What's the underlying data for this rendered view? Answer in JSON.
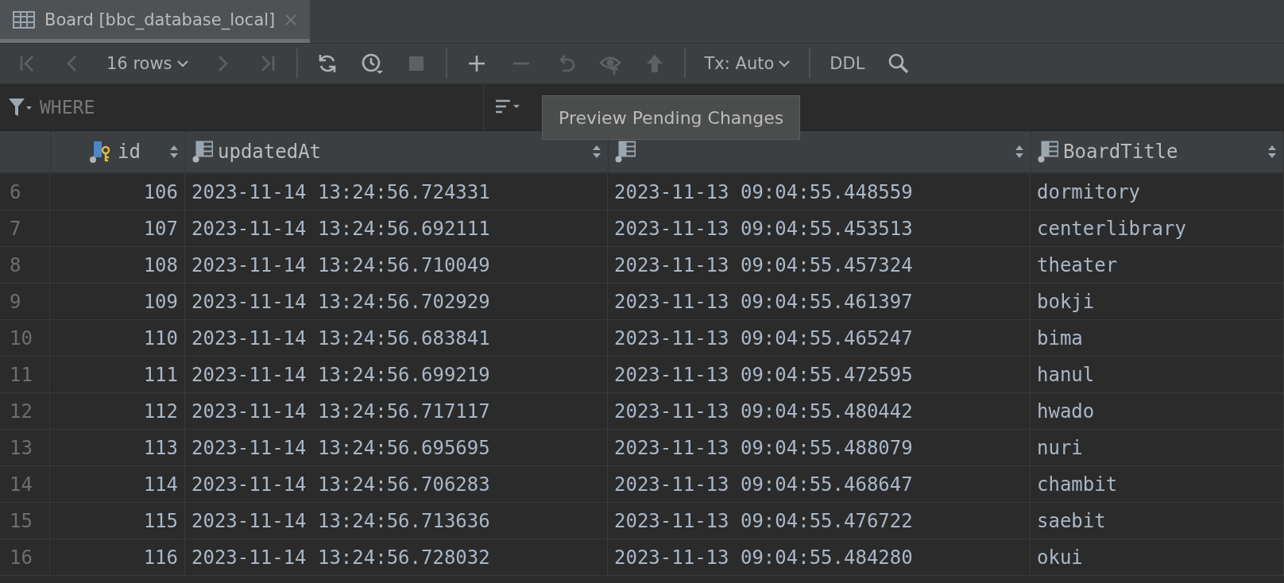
{
  "tab": {
    "title": "Board [bbc_database_local]",
    "selected": true
  },
  "toolbar": [
    [
      {
        "kind": "first",
        "disabled": true
      },
      {
        "kind": "prev",
        "disabled": true
      },
      {
        "kind": "dropdown",
        "label": "16 rows"
      },
      {
        "kind": "next",
        "disabled": true
      },
      {
        "kind": "last",
        "disabled": true
      }
    ],
    [
      {
        "kind": "reload",
        "disabled": false
      },
      {
        "kind": "history",
        "disabled": false
      },
      {
        "kind": "stop",
        "disabled": true
      }
    ],
    [
      {
        "kind": "add",
        "disabled": false
      },
      {
        "kind": "remove",
        "disabled": true
      },
      {
        "kind": "revert",
        "disabled": true
      },
      {
        "kind": "preview",
        "disabled": true
      },
      {
        "kind": "submit",
        "disabled": true
      }
    ],
    [
      {
        "kind": "dropdown",
        "label": "Tx: Auto"
      }
    ],
    [
      {
        "kind": "text",
        "label": "DDL"
      },
      {
        "kind": "search",
        "disabled": false
      }
    ]
  ],
  "where": {
    "placeholder": "WHERE"
  },
  "tooltip": {
    "text": "Preview Pending Changes"
  },
  "table": {
    "columns": [
      {
        "name": "id",
        "kind": "key"
      },
      {
        "name": "updatedAt",
        "kind": "column"
      },
      {
        "kind": "column"
      },
      {
        "name": "BoardTitle",
        "kind": "column"
      }
    ],
    "rows": [
      {
        "number": "6",
        "cells": [
          "106",
          "2023-11-14 13:24:56.724331",
          "2023-11-13 09:04:55.448559",
          "dormitory"
        ]
      },
      {
        "number": "7",
        "cells": [
          "107",
          "2023-11-14 13:24:56.692111",
          "2023-11-13 09:04:55.453513",
          "centerlibrary"
        ]
      },
      {
        "number": "8",
        "cells": [
          "108",
          "2023-11-14 13:24:56.710049",
          "2023-11-13 09:04:55.457324",
          "theater"
        ]
      },
      {
        "number": "9",
        "cells": [
          "109",
          "2023-11-14 13:24:56.702929",
          "2023-11-13 09:04:55.461397",
          "bokji"
        ]
      },
      {
        "number": "10",
        "cells": [
          "110",
          "2023-11-14 13:24:56.683841",
          "2023-11-13 09:04:55.465247",
          "bima"
        ]
      },
      {
        "number": "11",
        "cells": [
          "111",
          "2023-11-14 13:24:56.699219",
          "2023-11-13 09:04:55.472595",
          "hanul"
        ]
      },
      {
        "number": "12",
        "cells": [
          "112",
          "2023-11-14 13:24:56.717117",
          "2023-11-13 09:04:55.480442",
          "hwado"
        ]
      },
      {
        "number": "13",
        "cells": [
          "113",
          "2023-11-14 13:24:56.695695",
          "2023-11-13 09:04:55.488079",
          "nuri"
        ]
      },
      {
        "number": "14",
        "cells": [
          "114",
          "2023-11-14 13:24:56.706283",
          "2023-11-13 09:04:55.468647",
          "chambit"
        ]
      },
      {
        "number": "15",
        "cells": [
          "115",
          "2023-11-14 13:24:56.713636",
          "2023-11-13 09:04:55.476722",
          "saebit"
        ]
      },
      {
        "number": "16",
        "cells": [
          "116",
          "2023-11-14 13:24:56.728032",
          "2023-11-13 09:04:55.484280",
          "okui"
        ]
      }
    ]
  }
}
